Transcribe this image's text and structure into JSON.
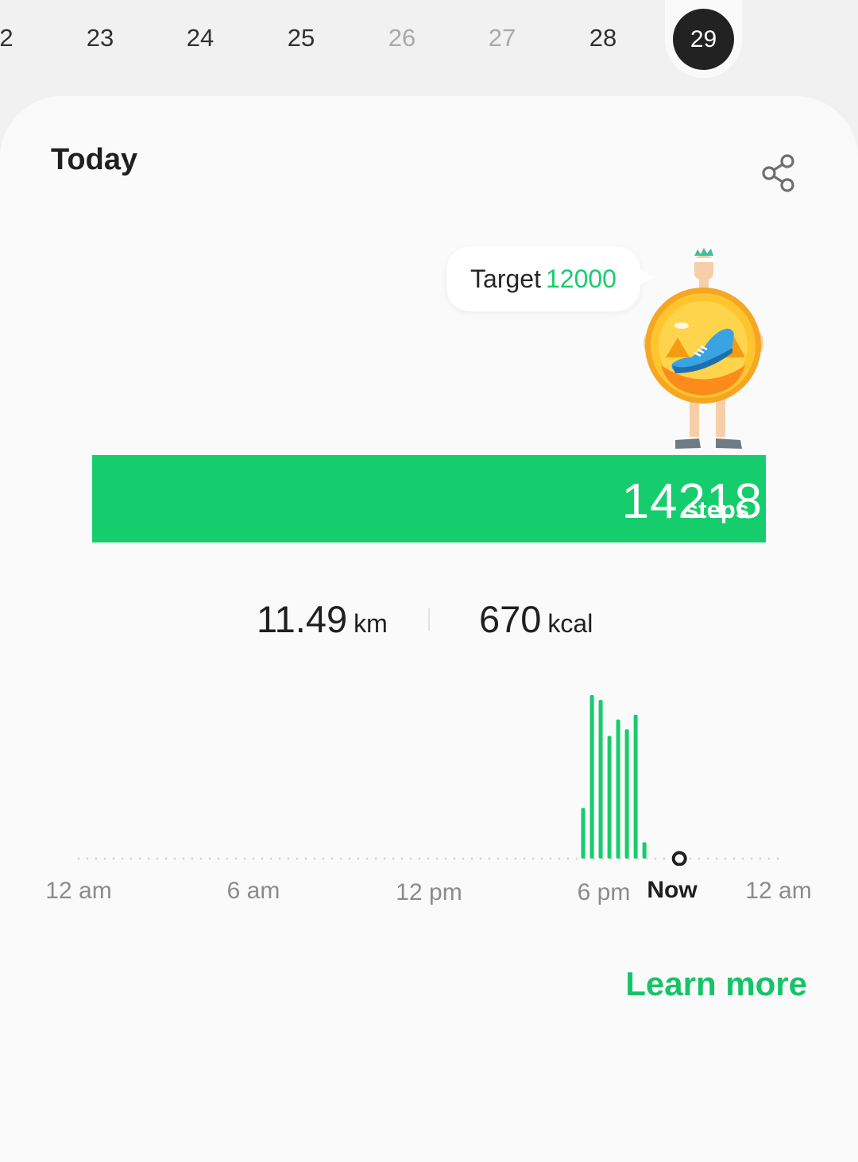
{
  "dates": [
    {
      "label": "2",
      "dim": false
    },
    {
      "label": "23",
      "dim": false
    },
    {
      "label": "24",
      "dim": false
    },
    {
      "label": "25",
      "dim": false
    },
    {
      "label": "26",
      "dim": true
    },
    {
      "label": "27",
      "dim": true
    },
    {
      "label": "28",
      "dim": false
    }
  ],
  "selected_date": "29",
  "card": {
    "title": "Today"
  },
  "target": {
    "label": "Target",
    "value": "12000"
  },
  "steps": {
    "value": "14218",
    "unit": "steps"
  },
  "stats": {
    "distance": {
      "value": "11.49",
      "unit": "km"
    },
    "calories": {
      "value": "670",
      "unit": "kcal"
    }
  },
  "chart_data": {
    "type": "bar",
    "x_axis_labels": [
      "12 am",
      "6 am",
      "12 pm",
      "6 pm",
      "Now",
      "12 am"
    ],
    "x_range_hours": [
      0,
      24
    ],
    "now_hour": 20.6,
    "series": [
      {
        "hours": [
          17.3,
          17.6,
          17.9,
          18.2,
          18.5,
          18.8,
          19.1,
          19.4
        ],
        "values": [
          0.31,
          1.0,
          0.97,
          0.75,
          0.85,
          0.79,
          0.88,
          0.1
        ]
      }
    ],
    "bar_color": "#15cd6c",
    "grid": false
  },
  "learn_more": "Learn more",
  "colors": {
    "accent_green": "#15cd6c",
    "selected_date_bg": "#222222"
  },
  "icons": {
    "share": "share-icon",
    "mascot": "mascot-illustration"
  }
}
